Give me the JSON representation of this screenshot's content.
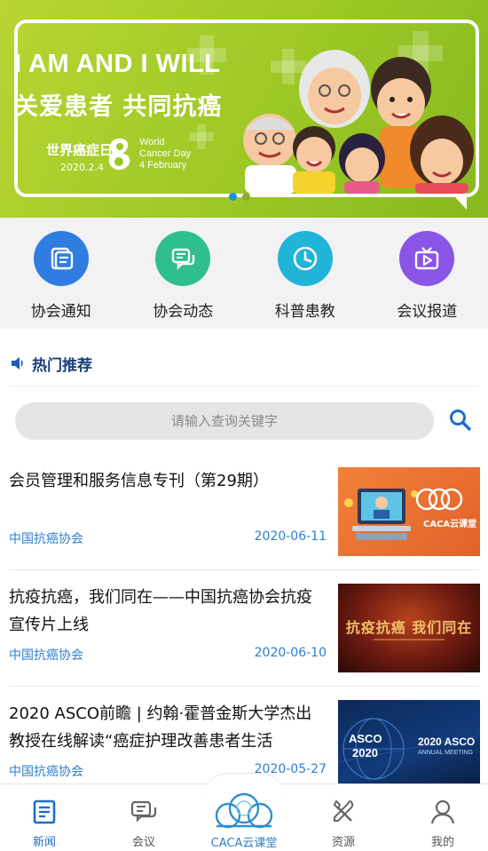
{
  "banner": {
    "headline_en": "I AM AND I WILL",
    "headline_cn": "关爱患者 共同抗癌",
    "day_cn": "世界癌症日",
    "date": "2020.2.4",
    "day_en_1": "World",
    "day_en_2": "Cancer Day",
    "day_en_3": "4 February",
    "slides": 2,
    "active_slide": 1
  },
  "categories": [
    {
      "label": "协会通知",
      "icon": "notice-icon",
      "color": "#2f7de1"
    },
    {
      "label": "协会动态",
      "icon": "chat-icon",
      "color": "#2fbf8f"
    },
    {
      "label": "科普患教",
      "icon": "clock-icon",
      "color": "#1fb4d8"
    },
    {
      "label": "会议报道",
      "icon": "video-icon",
      "color": "#8a55e6"
    }
  ],
  "hot": {
    "title": "热门推荐",
    "icon": "speaker-icon"
  },
  "search": {
    "placeholder": "请输入查询关键字",
    "icon": "search-icon"
  },
  "news": [
    {
      "title": "会员管理和服务信息专刊（第29期）",
      "source": "中国抗癌协会",
      "date": "2020-06-11",
      "thumb_text": "CACA云课堂"
    },
    {
      "title": "抗疫抗癌，我们同在——中国抗癌协会抗疫宣传片上线",
      "source": "中国抗癌协会",
      "date": "2020-06-10",
      "thumb_text": "抗疫抗癌 我们同在"
    },
    {
      "title": "2020 ASCO前瞻 | 约翰·霍普金斯大学杰出教授在线解读“癌症护理改善患者生活",
      "source": "中国抗癌协会",
      "date": "2020-05-27",
      "thumb_text_1": "ASCO",
      "thumb_text_2": "2020",
      "thumb_text_3": "2020 ASCO",
      "thumb_text_4": "ANNUAL MEETING"
    }
  ],
  "tabs": [
    {
      "label": "新闻",
      "icon": "news-icon",
      "active": true
    },
    {
      "label": "会议",
      "icon": "meeting-icon",
      "active": false
    },
    {
      "label": "CACA云课堂",
      "icon": "cloud-icon",
      "active": false
    },
    {
      "label": "资源",
      "icon": "tools-icon",
      "active": false
    },
    {
      "label": "我的",
      "icon": "profile-icon",
      "active": false
    }
  ],
  "colors": {
    "accent": "#1d6ec8",
    "link": "#2d7fd1",
    "banner_green": "#9cc826"
  }
}
